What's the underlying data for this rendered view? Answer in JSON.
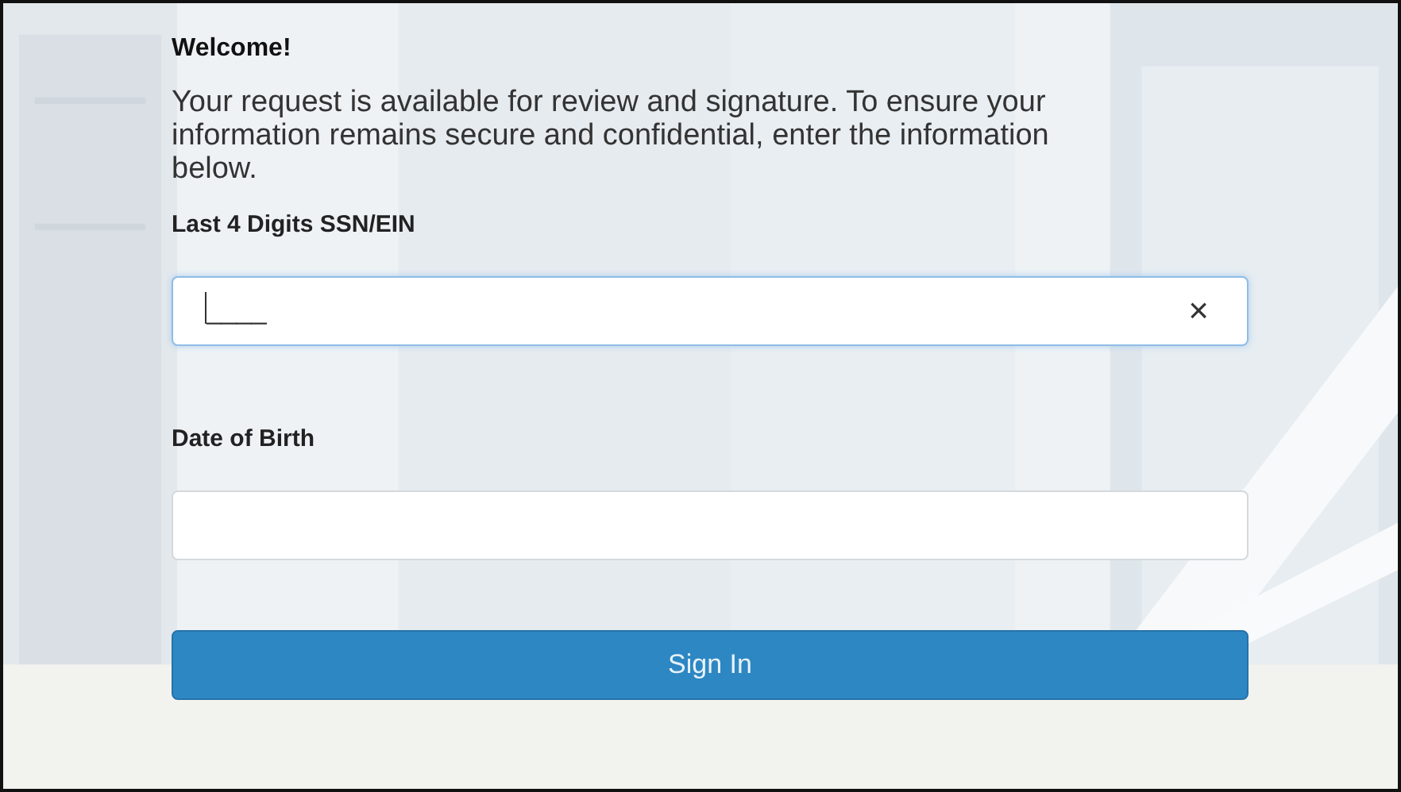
{
  "heading": "Welcome!",
  "intro": "Your request is available for review and signature. To ensure your information remains secure and confidential, enter the information below.",
  "fields": [
    {
      "label": "Last 4 Digits SSN/EIN",
      "value": "____",
      "focused": true,
      "clear_button": "×"
    },
    {
      "label": "Date of Birth",
      "focused": false
    }
  ],
  "button": "Sign In"
}
